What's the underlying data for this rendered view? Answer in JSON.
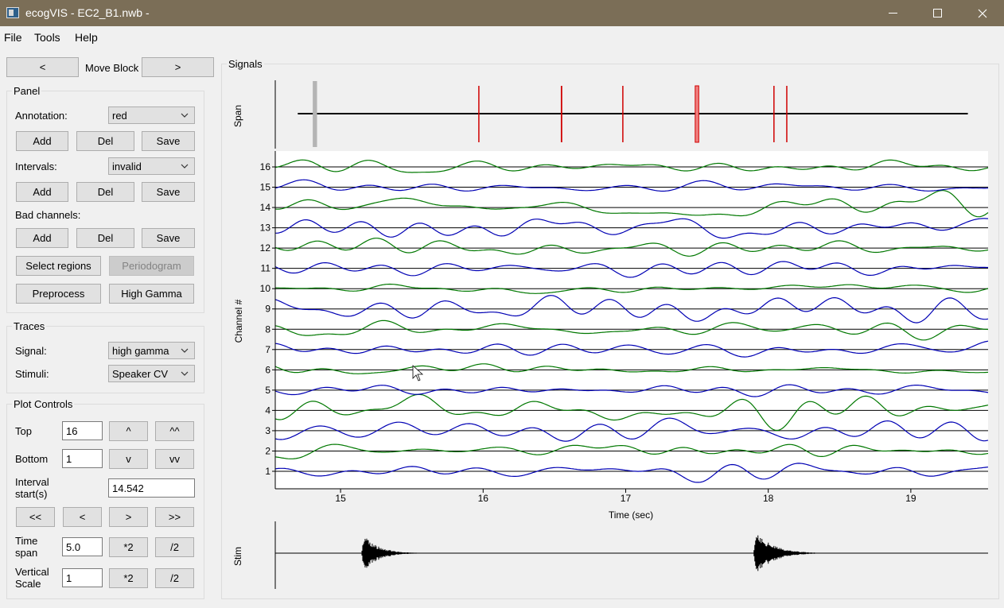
{
  "window": {
    "title": "ecogVIS - EC2_B1.nwb -"
  },
  "menu": [
    "File",
    "Tools",
    "Help"
  ],
  "move_block": {
    "prev": "<",
    "label": "Move Block",
    "next": ">"
  },
  "panel": {
    "title": "Panel",
    "annotation_label": "Annotation:",
    "annotation_value": "red",
    "intervals_label": "Intervals:",
    "intervals_value": "invalid",
    "bad_channels_label": "Bad channels:",
    "add": "Add",
    "del": "Del",
    "save": "Save",
    "select_regions": "Select regions",
    "periodogram": "Periodogram",
    "preprocess": "Preprocess",
    "high_gamma": "High Gamma"
  },
  "traces": {
    "title": "Traces",
    "signal_label": "Signal:",
    "signal_value": "high gamma",
    "stimuli_label": "Stimuli:",
    "stimuli_value": "Speaker CV"
  },
  "plot_controls": {
    "title": "Plot Controls",
    "top_label": "Top",
    "top_value": "16",
    "bottom_label": "Bottom",
    "bottom_value": "1",
    "up": "^",
    "up_up": "^^",
    "down": "v",
    "down_down": "vv",
    "interval_label": "Interval start(s)",
    "interval_value": "14.542",
    "nav": [
      "<<",
      "<",
      ">",
      ">>"
    ],
    "time_span_label": "Time span",
    "time_span_value": "5.0",
    "vertical_scale_label": "Vertical Scale",
    "vertical_scale_value": "1",
    "times2": "*2",
    "div2": "/2"
  },
  "signals": {
    "title": "Signals",
    "span_ylabel": "Span",
    "channel_ylabel": "Channel #",
    "xlabel": "Time (sec)",
    "stim_ylabel": "Stim"
  },
  "chart_data": {
    "type": "line",
    "x_range": [
      14.542,
      19.542
    ],
    "x_ticks": [
      15,
      16,
      17,
      18,
      19
    ],
    "channels": [
      1,
      2,
      3,
      4,
      5,
      6,
      7,
      8,
      9,
      10,
      11,
      12,
      13,
      14,
      15,
      16
    ],
    "channel_colors": [
      "#0000b4",
      "#007800"
    ],
    "baseline_color": "#000000",
    "span_markers": [
      {
        "t": 14.82,
        "width": 0.03,
        "color": "#b4b4b4",
        "type": "current"
      },
      {
        "t": 15.97,
        "width": 0.005,
        "color": "#d00000",
        "type": "annotation"
      },
      {
        "t": 16.55,
        "width": 0.01,
        "color": "#d00000",
        "type": "annotation"
      },
      {
        "t": 16.98,
        "width": 0.005,
        "color": "#d00000",
        "type": "annotation"
      },
      {
        "t": 17.5,
        "width": 0.025,
        "color": "#f08080",
        "type": "interval"
      },
      {
        "t": 18.04,
        "width": 0.005,
        "color": "#d00000",
        "type": "annotation"
      },
      {
        "t": 18.13,
        "width": 0.005,
        "color": "#d00000",
        "type": "annotation"
      }
    ],
    "span_range": [
      14.7,
      19.4
    ],
    "stim_bursts": [
      {
        "t": 15.15,
        "duration": 0.45,
        "peak": 0.8
      },
      {
        "t": 17.9,
        "duration": 0.5,
        "peak": 1.0
      }
    ]
  }
}
